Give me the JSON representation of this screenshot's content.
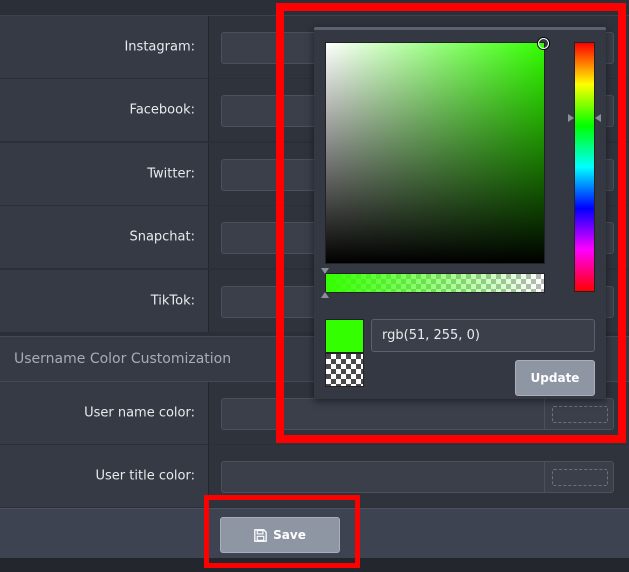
{
  "social_fields": [
    {
      "label": "Instagram:"
    },
    {
      "label": "Facebook:"
    },
    {
      "label": "Twitter:"
    },
    {
      "label": "Snapchat:"
    },
    {
      "label": "TikTok:"
    }
  ],
  "section_title": "Username Color Customization",
  "color_fields": [
    {
      "label": "User name color:"
    },
    {
      "label": "User title color:"
    }
  ],
  "footer": {
    "save_label": "Save"
  },
  "color_picker": {
    "value": "rgb(51, 255, 0)",
    "selected_color": "#33ff00",
    "update_label": "Update"
  },
  "colors": {
    "background": "#2b2f38",
    "panel": "#343843",
    "button": "#8e96a4",
    "highlight": "#ff0000"
  }
}
